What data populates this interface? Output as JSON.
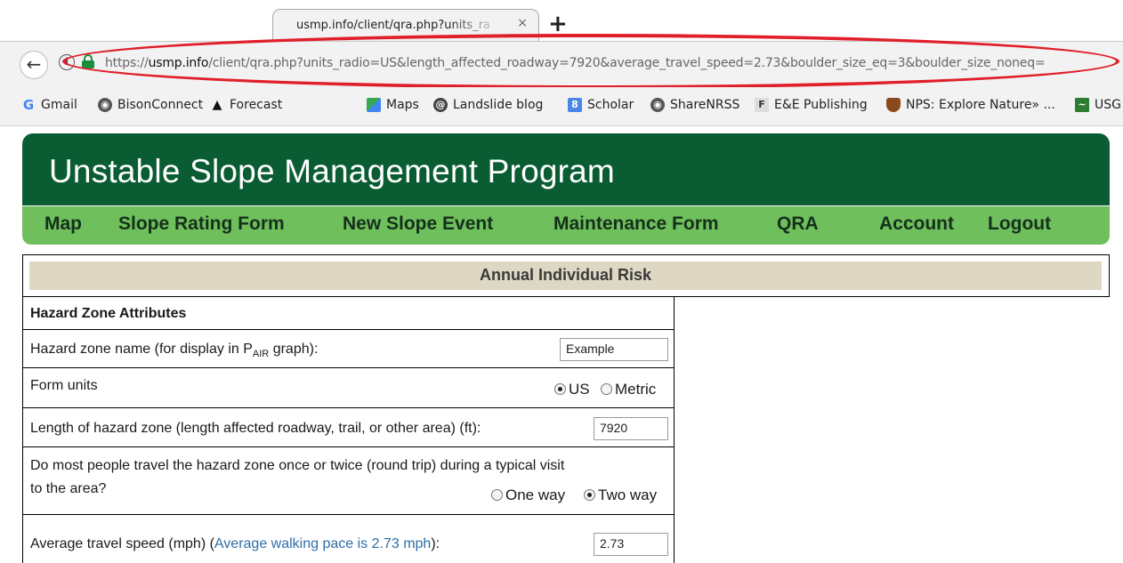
{
  "browser": {
    "tab_title": "usmp.info/client/qra.php?units_ra",
    "tab_close": "×",
    "new_tab": "+",
    "url_scheme": "https://",
    "url_domain": "usmp.info",
    "url_path": "/client/qra.php?units_radio=US&length_affected_roadway=7920&average_travel_speed=2.73&boulder_size_eq=3&boulder_size_noneq=",
    "highlight_color": "#e01f2a",
    "bookmarks": [
      {
        "label": "Gmail",
        "icon": "G"
      },
      {
        "label": "BisonConnect",
        "icon": "globe"
      },
      {
        "label": "Forecast",
        "icon": "drop"
      },
      {
        "label": "Maps",
        "icon": "maps"
      },
      {
        "label": "Landslide blog",
        "icon": "swirl"
      },
      {
        "label": "Scholar",
        "icon": "scholar"
      },
      {
        "label": "ShareNRSS",
        "icon": "globe"
      },
      {
        "label": "E&E Publishing",
        "icon": "ee"
      },
      {
        "label": "NPS: Explore Nature» ...",
        "icon": "nps"
      },
      {
        "label": "USG",
        "icon": "usgs"
      }
    ]
  },
  "site": {
    "title": "Unstable Slope Management Program",
    "header_color": "#0a5c32",
    "nav_color": "#6fbf5c",
    "nav": [
      "Map",
      "Slope Rating Form",
      "New Slope Event",
      "Maintenance Form",
      "QRA",
      "Account",
      "Logout"
    ]
  },
  "risk": {
    "title": "Annual Individual Risk"
  },
  "hazard": {
    "section_title": "Hazard Zone Attributes",
    "name_label_pre": "Hazard zone name (for display in P",
    "name_label_sub": "AIR",
    "name_label_post": " graph):",
    "name_value": "Example",
    "units_label": "Form units",
    "units_options": [
      "US",
      "Metric"
    ],
    "units_selected": "US",
    "length_label": "Length of hazard zone (length affected roadway, trail, or other area) (ft):",
    "length_value": "7920",
    "trip_label_line1": "Do most people travel the hazard zone once or twice (round trip) during a typical visit",
    "trip_label_line2": "to the area?",
    "trip_options": [
      "One way",
      "Two way"
    ],
    "trip_selected": "Two way",
    "speed_label": "Average travel speed (mph) (",
    "speed_link": "Average walking pace is 2.73 mph",
    "speed_label_post": "):",
    "speed_value": "2.73"
  }
}
